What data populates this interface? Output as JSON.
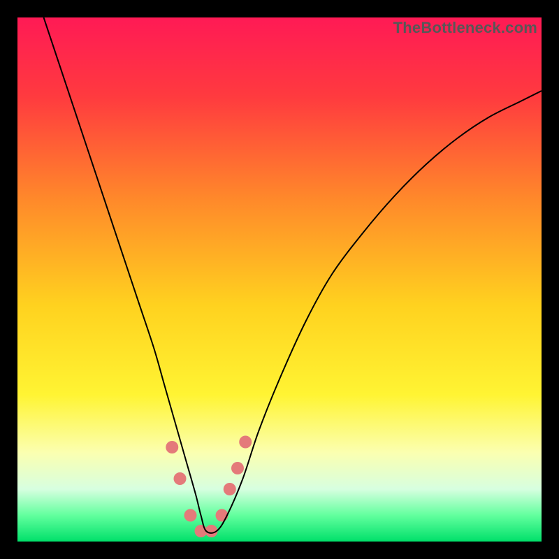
{
  "watermark": "TheBottleneck.com",
  "chart_data": {
    "type": "line",
    "title": "",
    "xlabel": "",
    "ylabel": "",
    "xlim": [
      0,
      100
    ],
    "ylim": [
      0,
      100
    ],
    "grid": false,
    "legend": false,
    "gradient_stops": [
      {
        "offset": 0.0,
        "color": "#ff1a55"
      },
      {
        "offset": 0.15,
        "color": "#ff3a3f"
      },
      {
        "offset": 0.35,
        "color": "#ff8a2a"
      },
      {
        "offset": 0.55,
        "color": "#ffd21f"
      },
      {
        "offset": 0.72,
        "color": "#fff433"
      },
      {
        "offset": 0.83,
        "color": "#fbffb0"
      },
      {
        "offset": 0.9,
        "color": "#d7ffe0"
      },
      {
        "offset": 0.95,
        "color": "#62ff9e"
      },
      {
        "offset": 1.0,
        "color": "#00e06a"
      }
    ],
    "series": [
      {
        "name": "bottleneck-curve",
        "stroke": "#000000",
        "stroke_width": 2,
        "x": [
          5,
          8,
          11,
          14,
          17,
          20,
          23,
          26,
          28,
          30,
          32,
          34,
          35,
          36,
          38,
          40,
          43,
          46,
          50,
          55,
          60,
          66,
          72,
          78,
          84,
          90,
          96,
          100
        ],
        "y": [
          100,
          91,
          82,
          73,
          64,
          55,
          46,
          37,
          30,
          23,
          16,
          9,
          5,
          2,
          2,
          5,
          12,
          21,
          31,
          42,
          51,
          59,
          66,
          72,
          77,
          81,
          84,
          86
        ]
      }
    ],
    "markers": {
      "name": "highlight-dots",
      "fill": "#e47a7a",
      "radius": 9,
      "x": [
        29.5,
        31,
        33,
        35,
        37,
        39,
        40.5,
        42,
        43.5
      ],
      "y": [
        18,
        12,
        5,
        2,
        2,
        5,
        10,
        14,
        19
      ]
    }
  }
}
